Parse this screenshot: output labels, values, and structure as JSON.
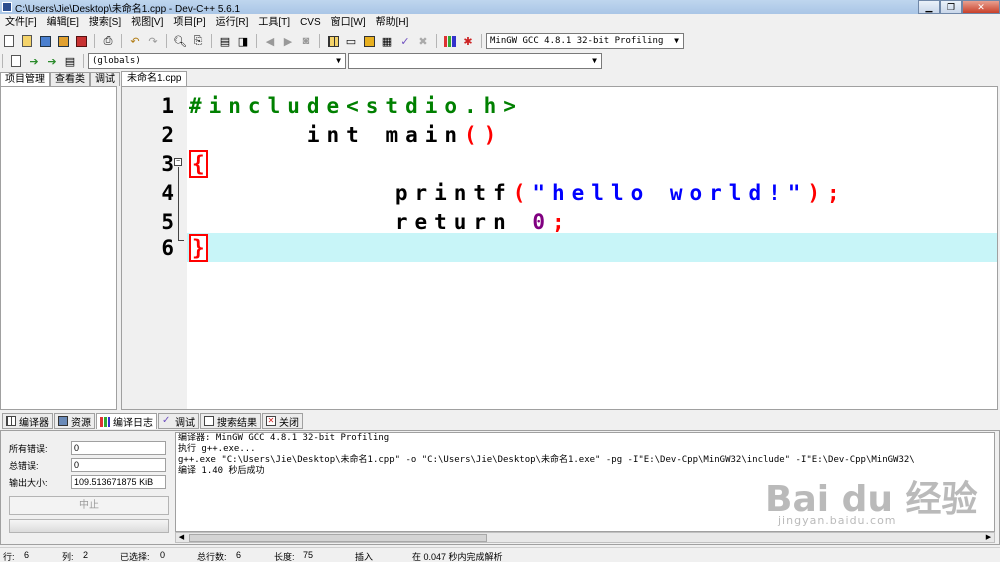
{
  "window": {
    "title": "C:\\Users\\Jie\\Desktop\\未命名1.cpp - Dev-C++ 5.6.1",
    "controls": [
      "minimize",
      "restore",
      "close"
    ]
  },
  "menu": [
    "文件[F]",
    "编辑[E]",
    "搜索[S]",
    "视图[V]",
    "项目[P]",
    "运行[R]",
    "工具[T]",
    "CVS",
    "窗口[W]",
    "帮助[H]"
  ],
  "toolbar": {
    "compiler": "MinGW GCC 4.8.1 32-bit Profiling",
    "scope": "(globals)",
    "member": ""
  },
  "left_panel": {
    "tabs": [
      "项目管理",
      "查看类",
      "调试"
    ]
  },
  "editor": {
    "file_tab": "未命名1.cpp",
    "current_line": 6,
    "lines": [
      {
        "num": "1",
        "text": "#include<stdio.h>"
      },
      {
        "num": "2",
        "text": "int main()"
      },
      {
        "num": "3",
        "text": "{"
      },
      {
        "num": "4",
        "text": "    printf(\"hello world!\");"
      },
      {
        "num": "5",
        "text": "    return 0;"
      },
      {
        "num": "6",
        "text": "}"
      }
    ],
    "tokens": {
      "l1_pre": "#include<stdio.h>",
      "l2_kw": "int",
      "l2_name": "main",
      "l2_paren": "()",
      "l3_brace": "{",
      "l4_func": "printf",
      "l4_open": "(",
      "l4_str": "\"hello world!\"",
      "l4_close": ");",
      "l5_kw": "return",
      "l5_num": "0",
      "l5_semi": ";",
      "l6_brace": "}"
    }
  },
  "bottom_tabs": [
    "编译器",
    "资源",
    "编译日志",
    "调试",
    "搜索结果",
    "关闭"
  ],
  "bottom_tab_active": "编译日志",
  "compile_stats": {
    "errors_label": "所有错误:",
    "errors_value": "0",
    "warnings_label": "总错误:",
    "warnings_value": "0",
    "output_size_label": "输出大小:",
    "output_size_value": "109.513671875 KiB",
    "abort_label": "中止"
  },
  "log_lines": [
    "编译器: MinGW GCC 4.8.1 32-bit Profiling",
    "执行 g++.exe...",
    "g++.exe \"C:\\Users\\Jie\\Desktop\\未命名1.cpp\" -o \"C:\\Users\\Jie\\Desktop\\未命名1.exe\" -pg -I\"E:\\Dev-Cpp\\MinGW32\\include\" -I\"E:\\Dev-Cpp\\MinGW32\\",
    "编译 1.40 秒后成功"
  ],
  "statusbar": {
    "row_label": "行:",
    "row_value": "6",
    "col_label": "列:",
    "col_value": "2",
    "selected_label": "已选择:",
    "selected_value": "0",
    "total_lines_label": "总行数:",
    "total_lines_value": "6",
    "length_label": "长度:",
    "length_value": "75",
    "insert_mode": "插入",
    "parse_info": "在 0.047 秒内完成解析"
  },
  "watermark": {
    "main": "Bai du 经验",
    "sub": "jingyan.baidu.com"
  }
}
